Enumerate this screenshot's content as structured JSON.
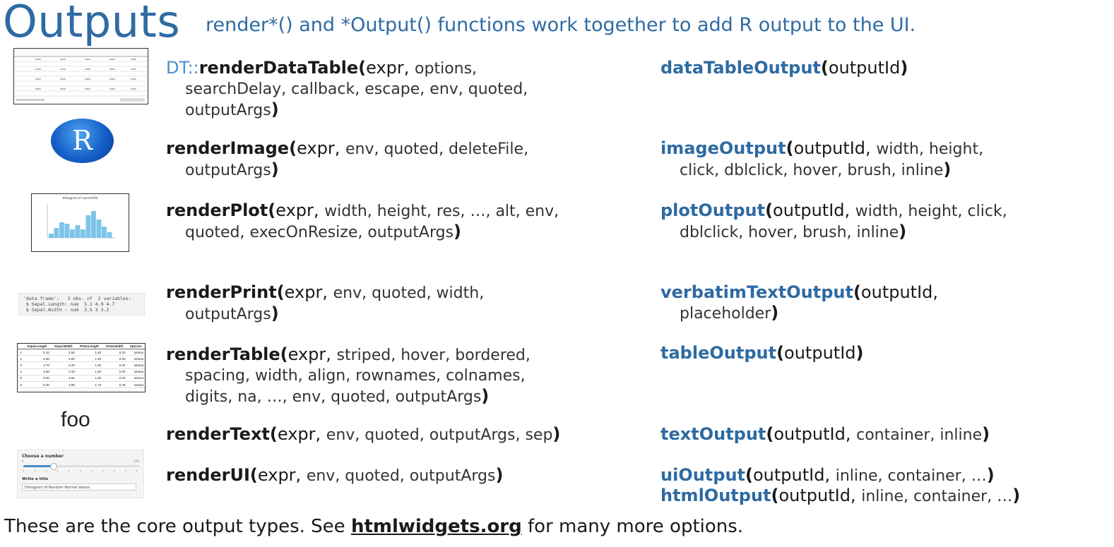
{
  "header": {
    "title": "Outputs",
    "subtitle": "render*()  and *Output() functions work together to add R output to the UI."
  },
  "rows": [
    {
      "prefix": "DT::",
      "render_fn": "renderDataTable",
      "render_first": "expr,",
      "render_args1": "options,",
      "render_line2": "searchDelay, callback, escape, env, quoted,",
      "render_line3": "outputArgs",
      "output_fn": "dataTableOutput",
      "output_first": "outputId"
    },
    {
      "render_fn": "renderImage",
      "render_first": "expr,",
      "render_args1": "env, quoted, deleteFile,",
      "render_line2": "outputArgs",
      "output_fn": "imageOutput",
      "output_first": "outputId,",
      "output_args1": "width, height,",
      "output_line2": "click, dblclick, hover, brush, inline"
    },
    {
      "render_fn": "renderPlot",
      "render_first": "expr,",
      "render_args1": "width, height, res, …, alt, env,",
      "render_line2": "quoted, execOnResize, outputArgs",
      "output_fn": "plotOutput",
      "output_first": "outputId,",
      "output_args1": "width, height, click,",
      "output_line2": "dblclick, hover, brush, inline"
    },
    {
      "render_fn": "renderPrint",
      "render_first": "expr,",
      "render_args1": "env, quoted, width,",
      "render_line2": "outputArgs",
      "output_fn": "verbatimTextOutput",
      "output_first": "outputId,",
      "output_line2": "placeholder"
    },
    {
      "render_fn": "renderTable",
      "render_first": "expr,",
      "render_args1": "striped, hover, bordered,",
      "render_line2": "spacing, width, align, rownames, colnames,",
      "render_line3": "digits, na, …, env, quoted, outputArgs",
      "output_fn": "tableOutput",
      "output_first": "outputId"
    },
    {
      "render_fn": "renderText",
      "render_first": "expr,",
      "render_args1": "env, quoted, outputArgs, sep",
      "output_fn": "textOutput",
      "output_first": "outputId,",
      "output_args1": "container, inline"
    },
    {
      "render_fn": "renderUI",
      "render_first": "expr,",
      "render_args1": "env, quoted, outputArgs",
      "output_fn": "uiOutput",
      "output_first": "outputId,",
      "output_args1": "inline, container, …",
      "output2_fn": "htmlOutput",
      "output2_first": "outputId,",
      "output2_args1": "inline, container, …"
    }
  ],
  "thumbs": {
    "r_logo_letter": "R",
    "foo_text": "foo",
    "print_lines": [
      "'data.frame':   3 obs. of  2 variables:",
      " $ Sepal.Length: num  5.1 4.9 4.7",
      " $ Sepal.Width : num  3.5 3 3.2"
    ],
    "table_headers": [
      "Sepal.Length",
      "Sepal.Width",
      "Petal.Length",
      "Petal.Width",
      "Species"
    ],
    "table_rows": [
      [
        "1",
        "5.10",
        "3.50",
        "1.40",
        "0.20",
        "setosa"
      ],
      [
        "2",
        "4.90",
        "3.00",
        "1.40",
        "0.20",
        "setosa"
      ],
      [
        "3",
        "4.70",
        "3.20",
        "1.30",
        "0.20",
        "setosa"
      ],
      [
        "4",
        "4.60",
        "3.10",
        "1.50",
        "0.20",
        "setosa"
      ],
      [
        "5",
        "5.00",
        "3.60",
        "1.40",
        "0.20",
        "setosa"
      ],
      [
        "6",
        "5.40",
        "3.90",
        "1.70",
        "0.40",
        "setosa"
      ]
    ],
    "plot_title": "Histogram of rnorm(500)",
    "ui_slider_label": "Choose a number",
    "ui_slider_min": "0",
    "ui_slider_max": "100",
    "ui_text_label": "Write a title",
    "ui_text_value": "Histogram of Random Normal Values"
  },
  "footer": {
    "before": "These are the core output types. See ",
    "link": "htmlwidgets.org",
    "after": " for many more options."
  },
  "colors": {
    "title": "#2f6ba3",
    "output_fn": "#2e6aa1",
    "dt_prefix": "#4a8fd0",
    "hist_bar": "#7ec4e8"
  }
}
